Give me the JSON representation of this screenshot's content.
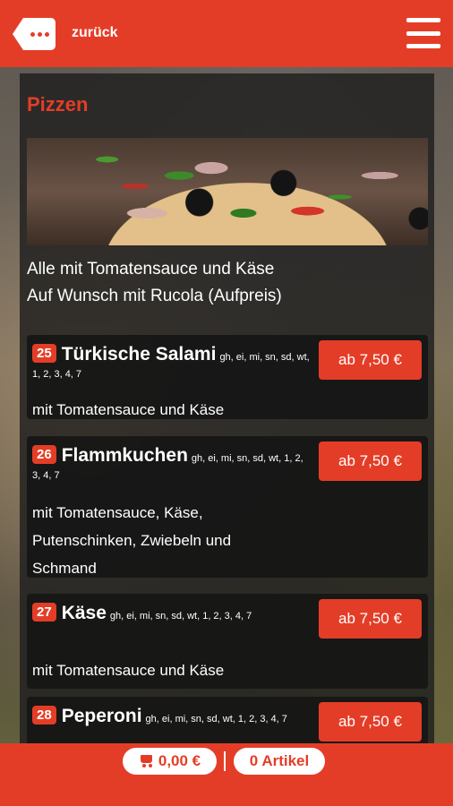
{
  "header": {
    "back_label": "zurück"
  },
  "section": {
    "title": "Pizzen",
    "intro_line1": "Alle mit Tomatensauce und Käse",
    "intro_line2": "Auf Wunsch mit Rucola (Aufpreis)"
  },
  "items": [
    {
      "number": "25",
      "name": "Türkische Salami",
      "allergens": "gh, ei, mi, sn, sd, wt, 1, 2, 3, 4, 7",
      "description": "mit Tomatensauce und Käse",
      "price": "ab 7,50 €"
    },
    {
      "number": "26",
      "name": "Flammkuchen",
      "allergens": "gh, ei, mi, sn, sd, wt, 1, 2, 3, 4, 7",
      "description": "mit Tomatensauce, Käse, Putenschinken, Zwiebeln und Schmand",
      "price": "ab 7,50 €"
    },
    {
      "number": "27",
      "name": "Käse",
      "allergens": "gh, ei, mi, sn, sd, wt, 1, 2, 3, 4, 7",
      "description": "mit Tomatensauce und Käse",
      "price": "ab 7,50 €"
    },
    {
      "number": "28",
      "name": "Peperoni",
      "allergens": "gh, ei, mi, sn, sd, wt, 1, 2, 3, 4, 7",
      "description": "",
      "price": "ab 7,50 €"
    }
  ],
  "footer": {
    "cart_total": "0,00 €",
    "articles": "0 Artikel"
  },
  "colors": {
    "accent": "#e43d27",
    "panel": "#1e1e1e"
  },
  "icons": {
    "back": "back-icon",
    "menu": "hamburger-menu-icon",
    "cart": "cart-icon"
  }
}
